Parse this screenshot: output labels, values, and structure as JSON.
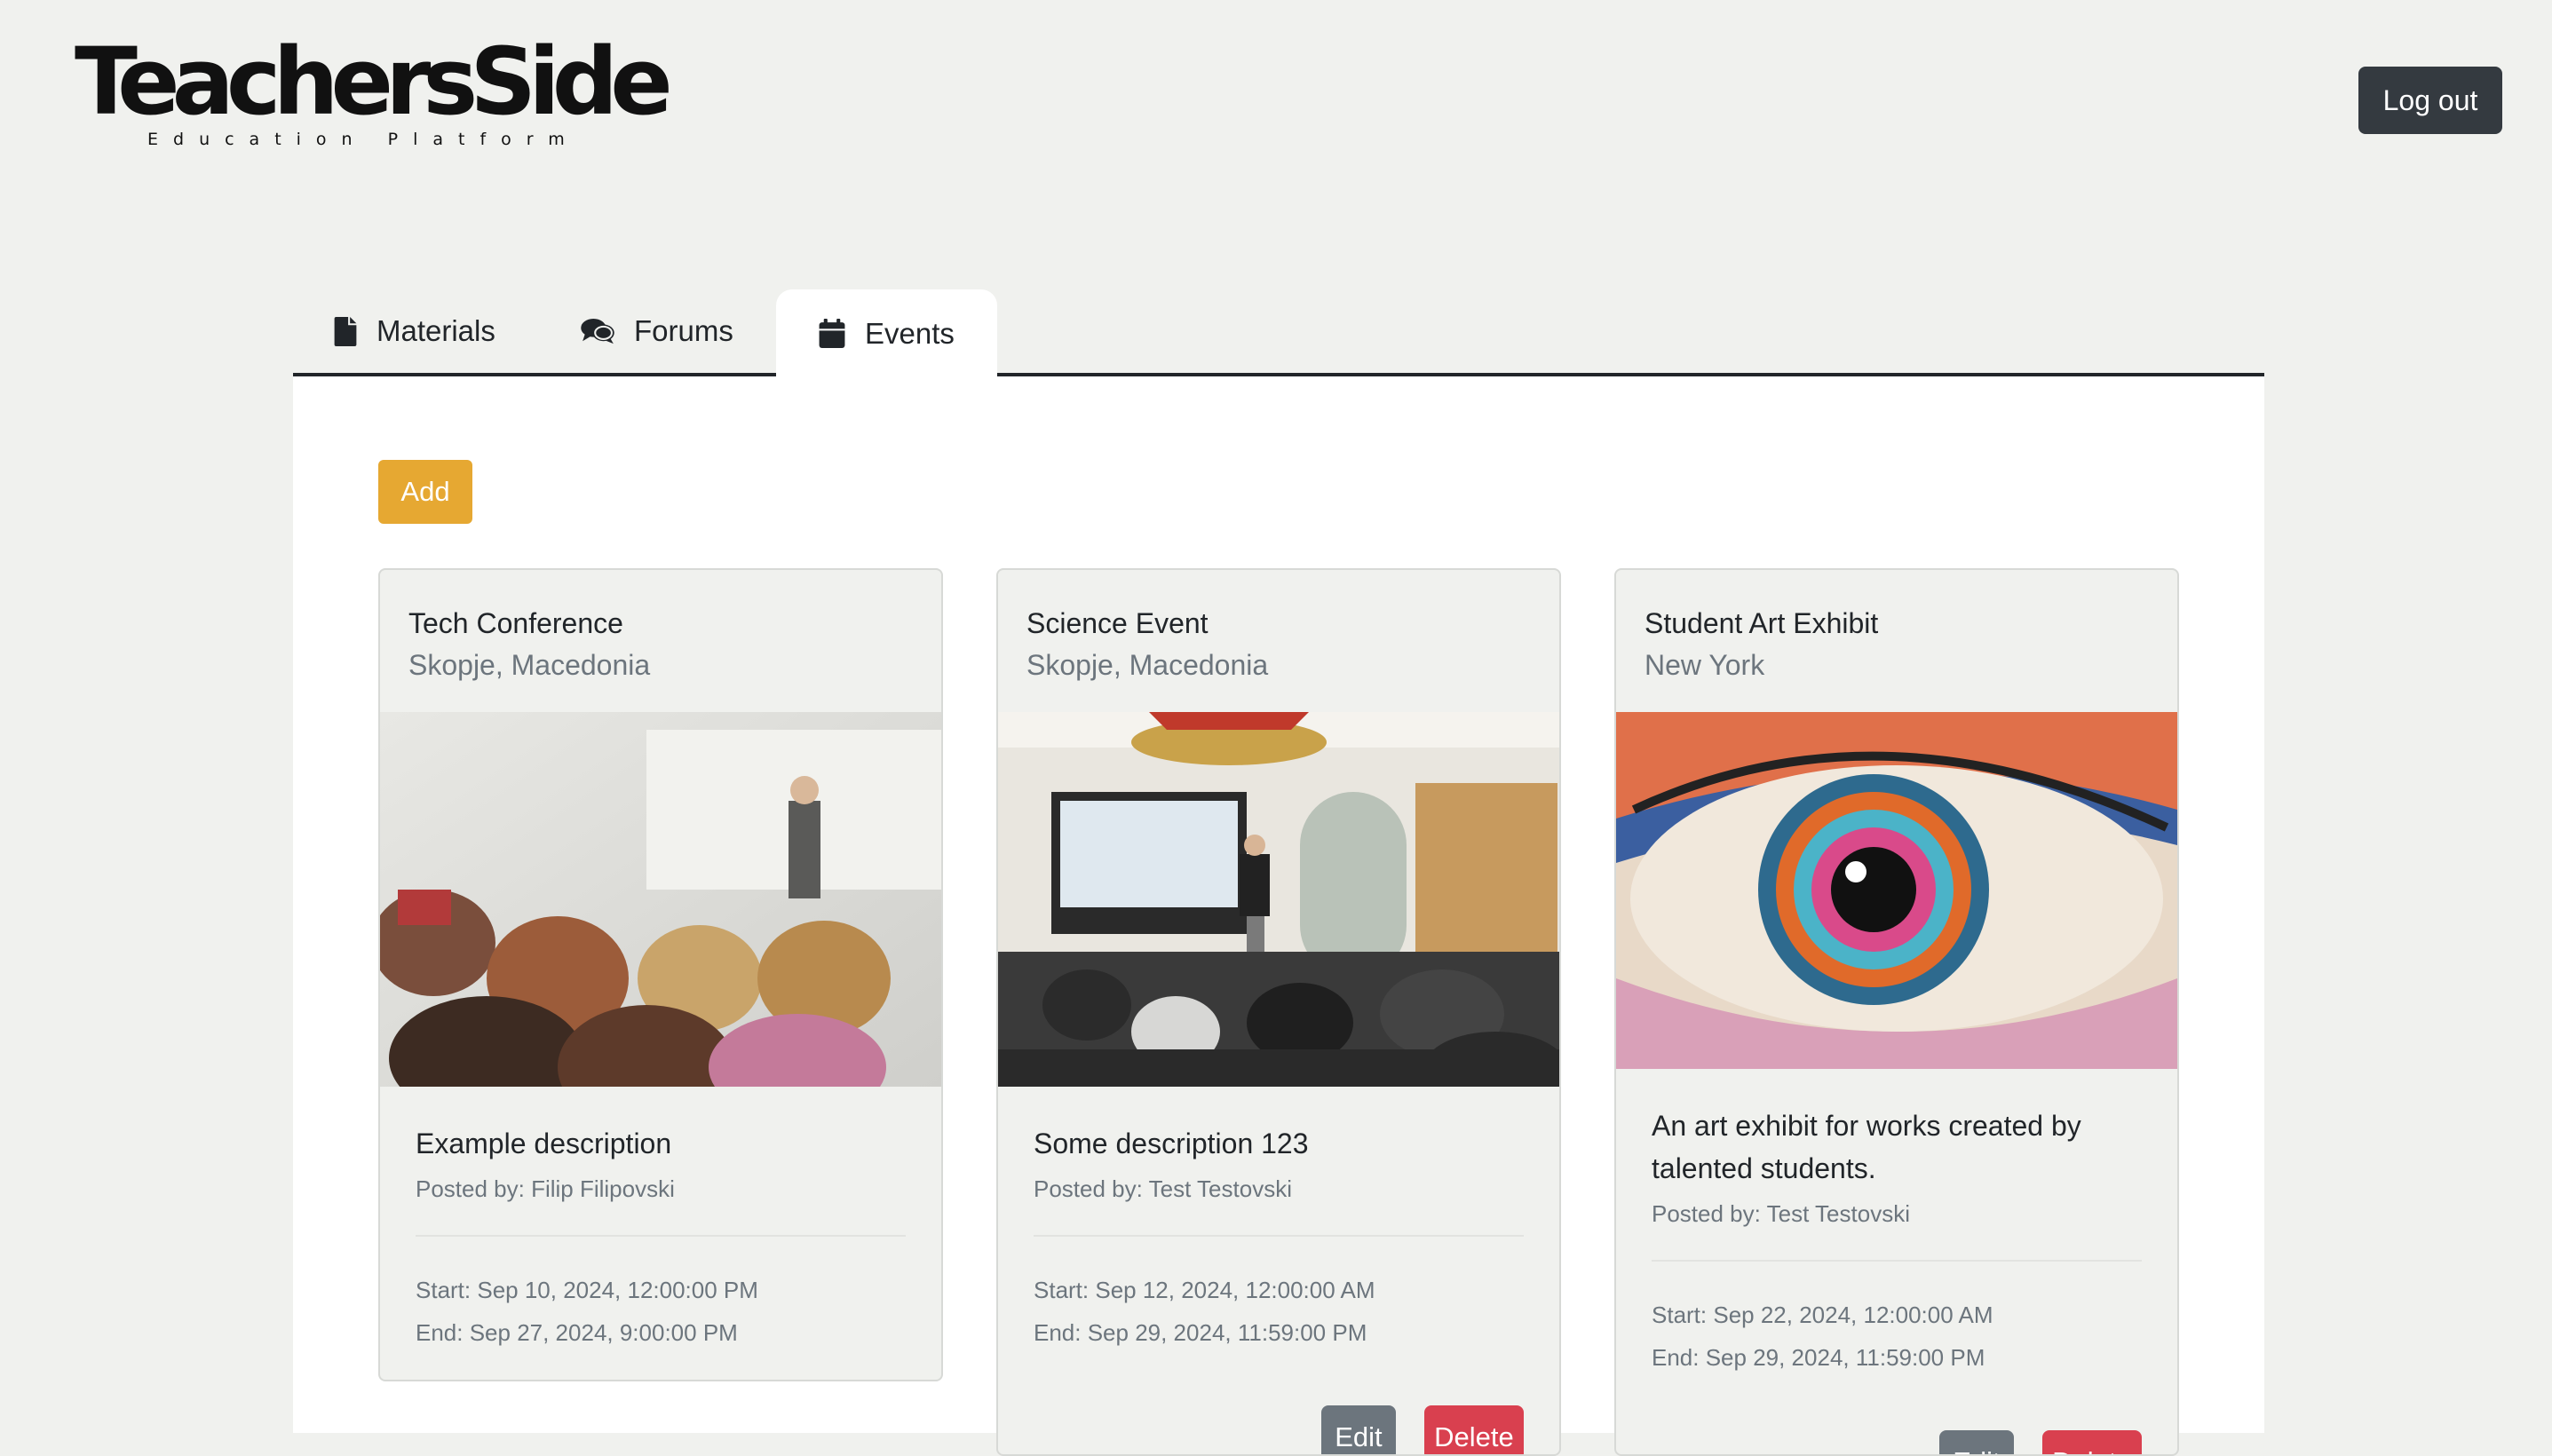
{
  "brand": {
    "name": "TeachersSide",
    "tagline": "Education Platform"
  },
  "header": {
    "logout_label": "Log out"
  },
  "tabs": [
    {
      "label": "Materials",
      "icon": "file-icon"
    },
    {
      "label": "Forums",
      "icon": "comments-icon"
    },
    {
      "label": "Events",
      "icon": "calendar-icon",
      "active": true
    }
  ],
  "toolbar": {
    "add_label": "Add"
  },
  "colors": {
    "add": "#e6a832",
    "edit": "#6c757d",
    "delete": "#d9404f",
    "logout": "#343a40",
    "page_bg": "#f0f1ee"
  },
  "events": [
    {
      "title": "Tech Conference",
      "location": "Skopje, Macedonia",
      "description": "Example description",
      "posted_by": "Posted by: Filip Filipovski",
      "start": "Start: Sep 10, 2024, 12:00:00 PM",
      "end": "End: Sep 27, 2024, 9:00:00 PM"
    },
    {
      "title": "Science Event",
      "location": "Skopje, Macedonia",
      "description": "Some description 123",
      "posted_by": "Posted by: Test Testovski",
      "start": "Start: Sep 12, 2024, 12:00:00 AM",
      "end": "End: Sep 29, 2024, 11:59:00 PM",
      "edit_label": "Edit",
      "delete_label": "Delete"
    },
    {
      "title": "Student Art Exhibit",
      "location": "New York",
      "description": "An art exhibit for works created by talented students.",
      "posted_by": "Posted by: Test Testovski",
      "start": "Start: Sep 22, 2024, 12:00:00 AM",
      "end": "End: Sep 29, 2024, 11:59:00 PM",
      "edit_label": "Edit",
      "delete_label": "Delete"
    }
  ]
}
